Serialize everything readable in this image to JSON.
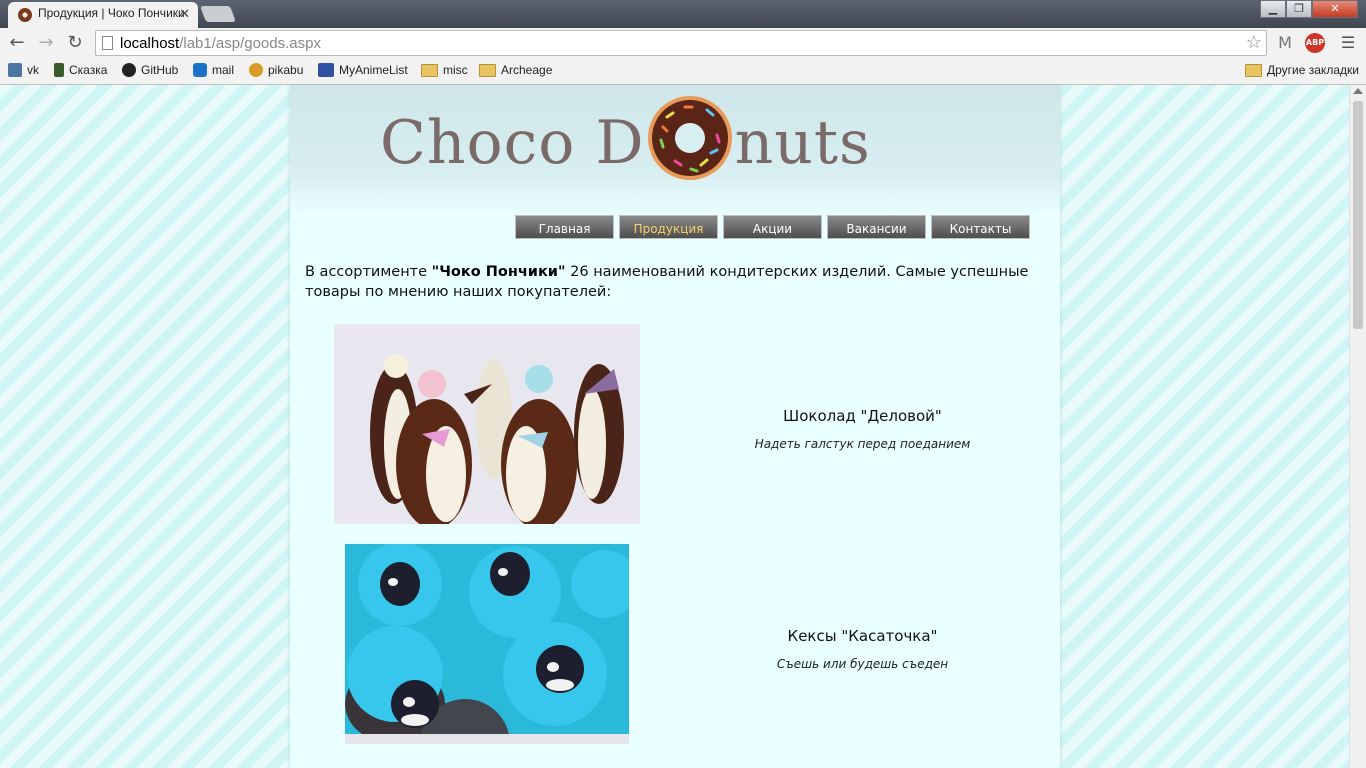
{
  "browser": {
    "tab_title": "Продукция | Чоко Пончики",
    "tab_close": "✕",
    "url_host": "localhost",
    "url_path": "/lab1/asp/goods.aspx",
    "window_buttons": [
      "▁",
      "❐",
      "✕"
    ],
    "extensions": [
      "M",
      "ABP"
    ],
    "bookmarks": [
      {
        "label": "vk",
        "icon": "vk-icon",
        "color": "#4c75a3"
      },
      {
        "label": "Сказка",
        "icon": "skazka-icon",
        "color": "#3b5b2a"
      },
      {
        "label": "GitHub",
        "icon": "github-icon",
        "color": "#222222"
      },
      {
        "label": "mail",
        "icon": "mail-icon",
        "color": "#1a73c8"
      },
      {
        "label": "pikabu",
        "icon": "pikabu-icon",
        "color": "#d99a28"
      },
      {
        "label": "MyAnimeList",
        "icon": "mal-icon",
        "color": "#2e51a2"
      },
      {
        "label": "misc",
        "icon": "folder-icon",
        "color": "#e8c463"
      },
      {
        "label": "Archeage",
        "icon": "folder-icon",
        "color": "#e8c463"
      }
    ],
    "other_bookmarks": "Другие закладки"
  },
  "site": {
    "logo_left": "Choco D",
    "logo_right": "nuts",
    "menu": [
      {
        "label": "Главная",
        "active": false
      },
      {
        "label": "Продукция",
        "active": true
      },
      {
        "label": "Акции",
        "active": false
      },
      {
        "label": "Вакансии",
        "active": false
      },
      {
        "label": "Контакты",
        "active": false
      }
    ],
    "intro_before": "В ассортименте ",
    "intro_brand": "\"Чоко Пончики\"",
    "intro_after": " 26 наименований кондитерских изделий. Самые успешные товары по мнению наших покупателей:",
    "products": [
      {
        "name": "Шоколад \"Деловой\"",
        "desc": "Надеть галстук перед поеданием",
        "image": "chocolate-penguins"
      },
      {
        "name": "Кексы \"Касаточка\"",
        "desc": "Съешь или будешь съеден",
        "image": "orca-cupcakes"
      }
    ]
  },
  "colors": {
    "page_bg": "#eaffff",
    "stripe_a": "#e8fbfa",
    "stripe_b": "#cff5f4",
    "menu_active_text": "#f7d06b"
  }
}
